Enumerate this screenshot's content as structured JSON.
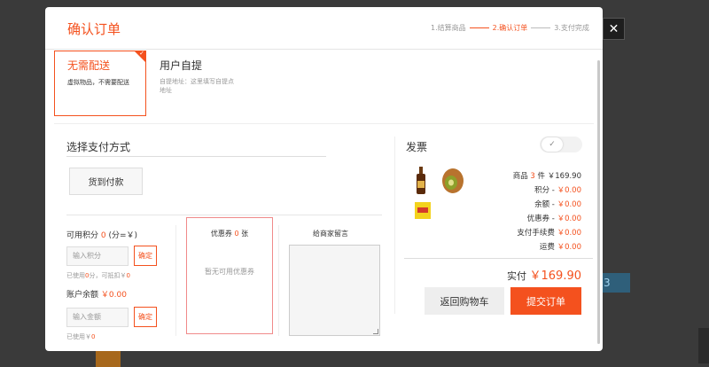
{
  "page": {
    "close_label": "✕",
    "background_badge": "3"
  },
  "modal": {
    "title": "确认订单",
    "steps": [
      "1.结算商品",
      "2.确认订单",
      "3.支付完成"
    ]
  },
  "delivery": {
    "selected_title": "无需配送",
    "selected_desc": "虚拟物品，不需要配送",
    "pickup_title": "用户自提",
    "pickup_desc": "自提地址：这里填写自提点地址"
  },
  "payment": {
    "title": "选择支付方式",
    "option_label": "货到付款"
  },
  "points": {
    "label_prefix": "可用积分",
    "available": "0",
    "label_suffix": "(分=￥)",
    "input_placeholder": "输入积分",
    "confirm_label": "确定",
    "note_prefix": "已使用",
    "used": "0",
    "note_mid": "分，可抵扣￥",
    "deduct": "0"
  },
  "balance": {
    "label_prefix": "账户余额",
    "amount": "￥0.00",
    "input_placeholder": "输入金额",
    "confirm_label": "确定",
    "note_prefix": "已使用￥",
    "used": "0"
  },
  "coupon": {
    "title_prefix": "优惠券",
    "count": "0",
    "title_suffix": "张",
    "empty_text": "暂无可用优惠券"
  },
  "message": {
    "title": "给商家留言"
  },
  "invoice": {
    "label": "发票",
    "toggle_check": "✓"
  },
  "summary": {
    "items_prefix": "商品",
    "items_count": "3",
    "items_suffix": "件",
    "items_amount": "￥169.90",
    "points_label": "积分 - ",
    "points_amount": "￥0.00",
    "balance_label": "余额 - ",
    "balance_amount": "￥0.00",
    "coupon_label": "优惠券 - ",
    "coupon_amount": "￥0.00",
    "fee_label": "支付手续费",
    "fee_amount": "￥0.00",
    "shipping_label": "运费",
    "shipping_amount": "￥0.00",
    "total_label": "实付",
    "total_amount": "￥169.90",
    "back_label": "返回购物车",
    "submit_label": "提交订单"
  },
  "colors": {
    "accent": "#f4511e",
    "coupon_border": "#f08a8a"
  }
}
